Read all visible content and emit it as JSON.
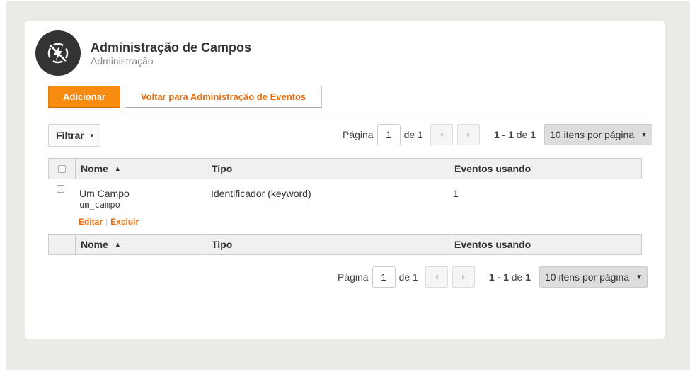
{
  "header": {
    "title": "Administração de Campos",
    "subtitle": "Administração",
    "logo_icon": "no-flash-icon"
  },
  "toolbar": {
    "add_label": "Adicionar",
    "back_label": "Voltar para Administração de Eventos",
    "filter_label": "Filtrar"
  },
  "colors": {
    "accent": "#f78c11",
    "link": "#e86d0d",
    "logo_bg": "#333333"
  },
  "pager_top": {
    "page_label": "Página",
    "page_value": "1",
    "of_label": "de 1",
    "range": "1 - 1",
    "range_of": "de",
    "total": "1",
    "per_page": "10 itens por página"
  },
  "pager_bottom": {
    "page_label": "Página",
    "page_value": "1",
    "of_label": "de 1",
    "range": "1 - 1",
    "range_of": "de",
    "total": "1",
    "per_page": "10 itens por página"
  },
  "table": {
    "columns": [
      "Nome",
      "Tipo",
      "Eventos usando"
    ],
    "sorted_by": "Nome",
    "sort_direction": "ascending",
    "rows": [
      {
        "name": "Um Campo",
        "code": "um_campo",
        "type": "Identificador (keyword)",
        "count": "1",
        "edit": "Editar",
        "delete": "Excluir",
        "separator": "|"
      }
    ]
  }
}
